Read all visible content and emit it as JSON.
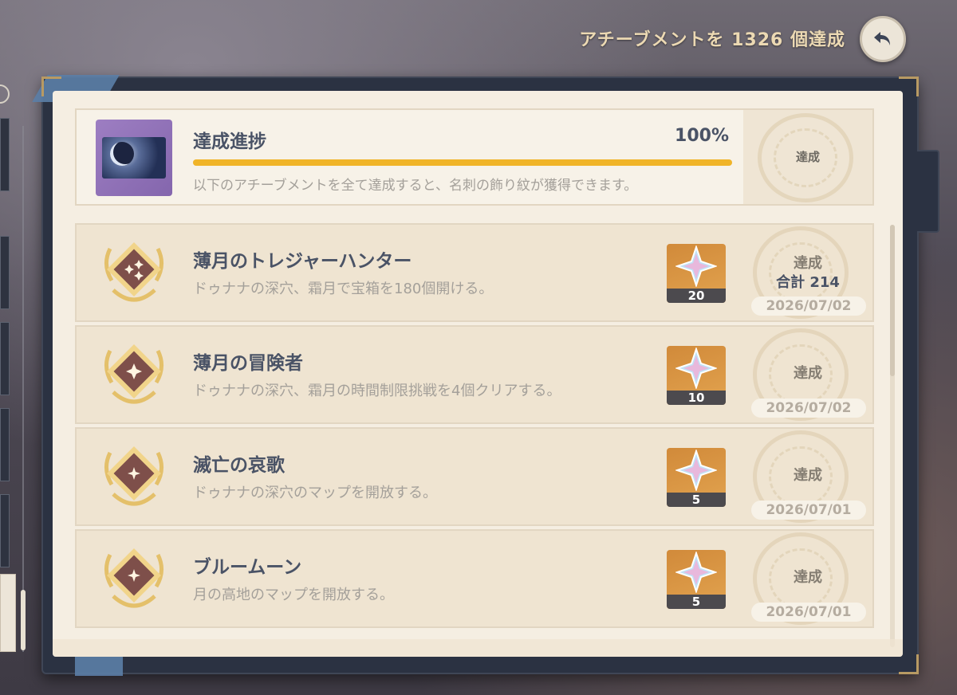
{
  "header": {
    "total_text": "アチーブメントを 1326 個達成"
  },
  "summary": {
    "title": "達成進捗",
    "percent": "100%",
    "progress_fraction": 1.0,
    "description": "以下のアチーブメントを全て達成すると、名刺の飾り紋が獲得できます。",
    "state": "達成"
  },
  "achievements": [
    {
      "title": "薄月のトレジャーハンター",
      "description": "ドゥナナの深穴、霜月で宝箱を180個開ける。",
      "reward_count": "20",
      "state": "達成",
      "total": "合計 214",
      "date": "2026/07/02"
    },
    {
      "title": "薄月の冒険者",
      "description": "ドゥナナの深穴、霜月の時間制限挑戦を4個クリアする。",
      "reward_count": "10",
      "state": "達成",
      "date": "2026/07/02"
    },
    {
      "title": "滅亡の哀歌",
      "description": "ドゥナナの深穴のマップを開放する。",
      "reward_count": "5",
      "state": "達成",
      "date": "2026/07/01"
    },
    {
      "title": "ブルームーン",
      "description": "月の高地のマップを開放する。",
      "reward_count": "5",
      "state": "達成",
      "date": "2026/07/01"
    }
  ],
  "colors": {
    "accent": "#f0b428",
    "title_text": "#4a5366",
    "desc_text": "#a4a09a",
    "paper": "#f5eee2"
  },
  "icons": {
    "back": "back-arrow-icon",
    "reward": "primogem-icon",
    "badge": "achievement-badge-icon",
    "stamp": "completion-stamp-icon"
  }
}
